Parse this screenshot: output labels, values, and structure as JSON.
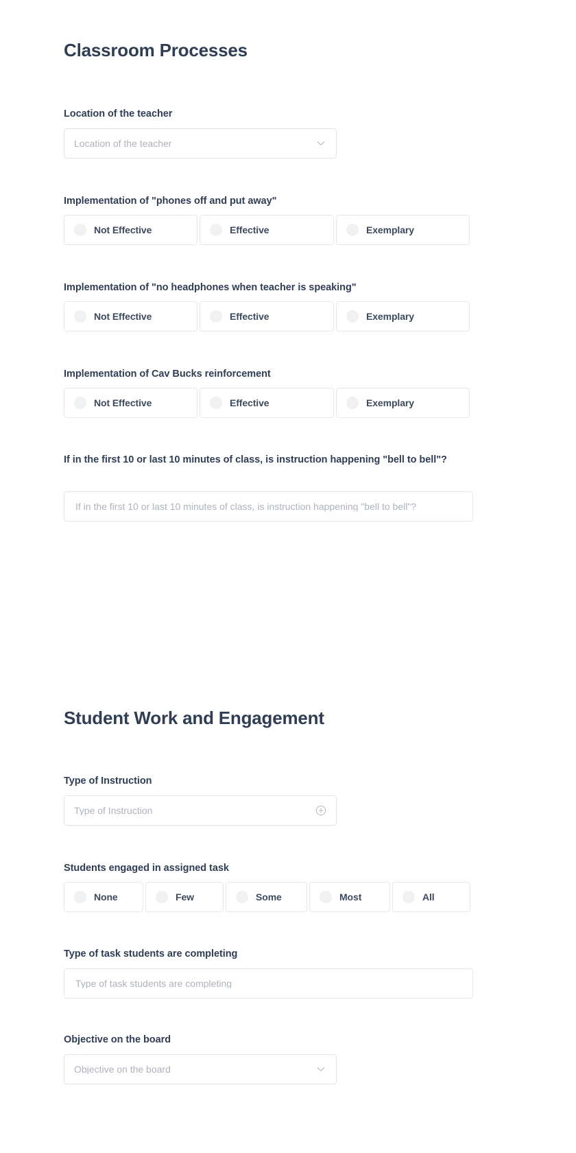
{
  "sections": [
    {
      "title": "Classroom Processes",
      "fields": [
        {
          "label": "Location of the teacher",
          "type": "select",
          "placeholder": "Location of the teacher",
          "icon": "chevron-down-icon"
        },
        {
          "label": "Implementation of \"phones off and put away\"",
          "type": "radio",
          "options": [
            "Not Effective",
            "Effective",
            "Exemplary"
          ]
        },
        {
          "label": "Implementation of \"no headphones when teacher is speaking\"",
          "type": "radio",
          "options": [
            "Not Effective",
            "Effective",
            "Exemplary"
          ]
        },
        {
          "label": "Implementation of Cav Bucks reinforcement",
          "type": "radio",
          "options": [
            "Not Effective",
            "Effective",
            "Exemplary"
          ]
        },
        {
          "label": "If in the first 10 or last 10 minutes of class, is instruction happening \"bell to bell\"?",
          "type": "text",
          "placeholder": "If in the first 10 or last 10 minutes of class, is instruction happening \"bell to bell\"?"
        }
      ]
    },
    {
      "title": "Student Work and Engagement",
      "fields": [
        {
          "label": "Type of Instruction",
          "type": "select",
          "placeholder": "Type of Instruction",
          "icon": "plus-circle-icon"
        },
        {
          "label": "Students engaged in assigned task",
          "type": "radio",
          "options": [
            "None",
            "Few",
            "Some",
            "Most",
            "All"
          ]
        },
        {
          "label": "Type of task students are completing",
          "type": "text",
          "placeholder": "Type of task students are completing"
        },
        {
          "label": "Objective on the board",
          "type": "select",
          "placeholder": "Objective on the board",
          "icon": "chevron-down-icon"
        }
      ]
    }
  ],
  "colors": {
    "heading": "#2f3e54",
    "label": "#2f3e54",
    "placeholder": "#aeb2bd",
    "border": "#e6e8eb",
    "radio_fill": "#f0f1f2",
    "background": "#ffffff"
  }
}
